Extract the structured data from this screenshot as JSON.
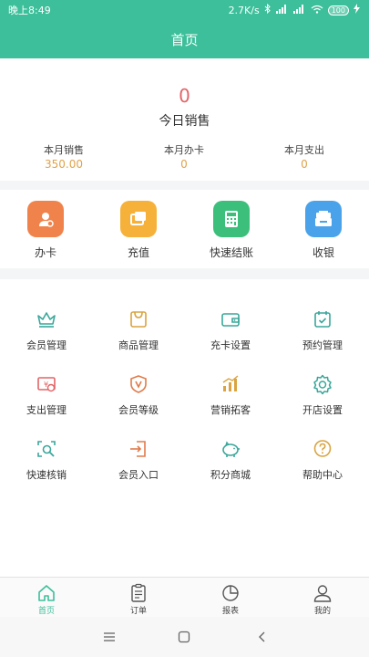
{
  "status_bar": {
    "time": "晚上8:49",
    "network_speed": "2.7K/s",
    "battery": "100"
  },
  "header": {
    "title": "首页"
  },
  "summary": {
    "today_value": "0",
    "today_label": "今日销售",
    "stats": [
      {
        "label": "本月销售",
        "value": "350.00"
      },
      {
        "label": "本月办卡",
        "value": "0"
      },
      {
        "label": "本月支出",
        "value": "0"
      }
    ]
  },
  "quick_actions": [
    {
      "label": "办卡",
      "icon": "card-person-icon",
      "color": "#f0834b"
    },
    {
      "label": "充值",
      "icon": "recharge-icon",
      "color": "#f6b13a"
    },
    {
      "label": "快速结账",
      "icon": "calculator-icon",
      "color": "#3cbf7a"
    },
    {
      "label": "收银",
      "icon": "cashier-icon",
      "color": "#4aa3ea"
    }
  ],
  "menu": [
    {
      "label": "会员管理",
      "icon": "crown-icon"
    },
    {
      "label": "商品管理",
      "icon": "shopping-bag-icon"
    },
    {
      "label": "充卡设置",
      "icon": "wallet-icon"
    },
    {
      "label": "预约管理",
      "icon": "calendar-icon"
    },
    {
      "label": "支出管理",
      "icon": "money-bill-icon"
    },
    {
      "label": "会员等级",
      "icon": "shield-v-icon"
    },
    {
      "label": "营销拓客",
      "icon": "bar-chart-icon"
    },
    {
      "label": "开店设置",
      "icon": "gear-icon"
    },
    {
      "label": "快速核销",
      "icon": "scan-search-icon"
    },
    {
      "label": "会员入口",
      "icon": "login-icon"
    },
    {
      "label": "积分商城",
      "icon": "piggy-bank-icon"
    },
    {
      "label": "帮助中心",
      "icon": "help-icon"
    }
  ],
  "tabs": [
    {
      "label": "首页",
      "icon": "home-icon",
      "active": true
    },
    {
      "label": "订单",
      "icon": "clipboard-icon",
      "active": false
    },
    {
      "label": "报表",
      "icon": "pie-chart-icon",
      "active": false
    },
    {
      "label": "我的",
      "icon": "user-icon",
      "active": false
    }
  ],
  "colors": {
    "brand": "#3cbf9a",
    "today_value": "#e26467",
    "stat_value": "#e0a24a",
    "teal_icon": "#3aa79a",
    "gold_icon": "#d9a441"
  }
}
